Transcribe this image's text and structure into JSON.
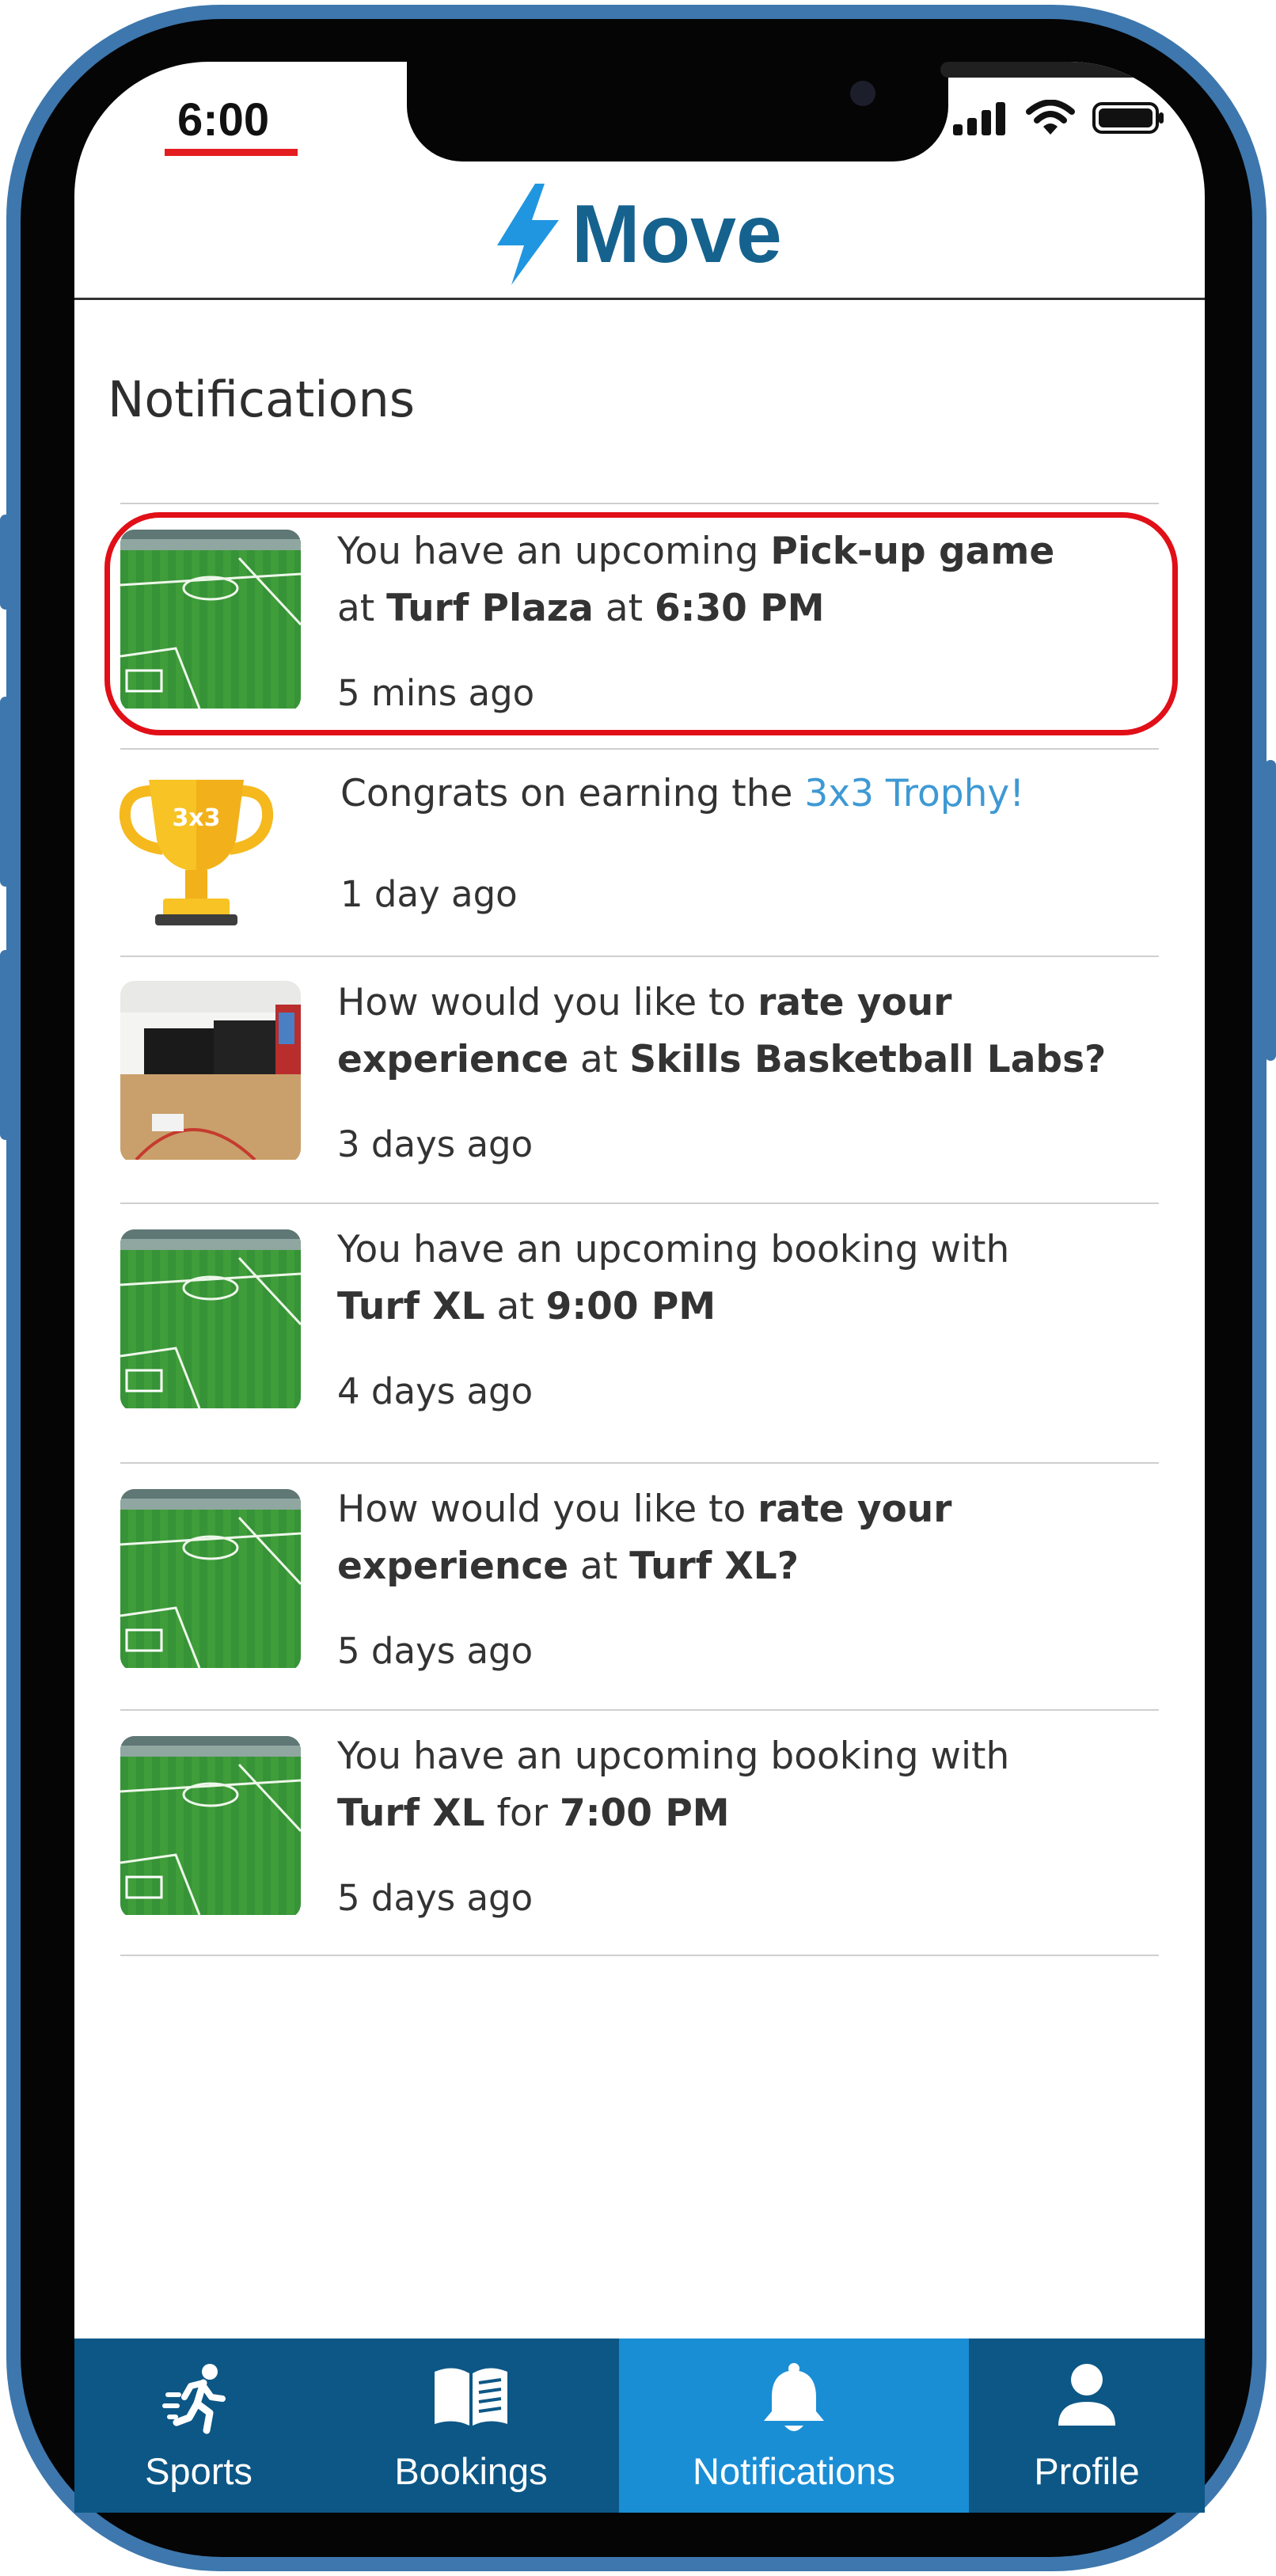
{
  "status_bar": {
    "time": "6:00"
  },
  "app": {
    "name": "Move"
  },
  "page": {
    "title": "Notifications"
  },
  "notifications": [
    {
      "thumb": "turf-field-photo",
      "line1": [
        {
          "text": "You have an upcoming ",
          "bold": false
        },
        {
          "text": "Pick-up game",
          "bold": true
        }
      ],
      "line2": [
        {
          "text": "at ",
          "bold": false
        },
        {
          "text": "Turf Plaza",
          "bold": true
        },
        {
          "text": " at ",
          "bold": false
        },
        {
          "text": "6:30 PM",
          "bold": true
        }
      ],
      "time": "5 mins ago",
      "highlighted": true
    },
    {
      "thumb": "trophy-icon",
      "trophy_label": "3x3",
      "line1": [
        {
          "text": "Congrats on earning the ",
          "bold": false
        },
        {
          "text": "3x3 Trophy!",
          "bold": false,
          "link": true
        }
      ],
      "line2": [],
      "time": "1 day ago"
    },
    {
      "thumb": "basketball-court-photo",
      "line1": [
        {
          "text": "How would you like to ",
          "bold": false
        },
        {
          "text": "rate your",
          "bold": true
        }
      ],
      "line2": [
        {
          "text": "experience",
          "bold": true
        },
        {
          "text": " at ",
          "bold": false
        },
        {
          "text": "Skills Basketball Labs?",
          "bold": true
        }
      ],
      "time": "3 days ago"
    },
    {
      "thumb": "turf-field-photo",
      "line1": [
        {
          "text": "You have an upcoming booking with",
          "bold": false
        }
      ],
      "line2": [
        {
          "text": "Turf XL",
          "bold": true
        },
        {
          "text": " at ",
          "bold": false
        },
        {
          "text": "9:00 PM",
          "bold": true
        }
      ],
      "time": "4 days ago"
    },
    {
      "thumb": "turf-field-photo",
      "line1": [
        {
          "text": "How would you like to ",
          "bold": false
        },
        {
          "text": "rate your",
          "bold": true
        }
      ],
      "line2": [
        {
          "text": "experience",
          "bold": true
        },
        {
          "text": " at ",
          "bold": false
        },
        {
          "text": "Turf XL?",
          "bold": true
        }
      ],
      "time": "5 days ago"
    },
    {
      "thumb": "turf-field-photo",
      "line1": [
        {
          "text": "You have an upcoming booking with",
          "bold": false
        }
      ],
      "line2": [
        {
          "text": "Turf XL",
          "bold": true
        },
        {
          "text": " for ",
          "bold": false
        },
        {
          "text": "7:00 PM",
          "bold": true
        }
      ],
      "time": "5 days ago"
    }
  ],
  "nav": {
    "items": [
      {
        "label": "Sports",
        "icon": "running-person-icon",
        "active": false
      },
      {
        "label": "Bookings",
        "icon": "open-book-icon",
        "active": false
      },
      {
        "label": "Notifications",
        "icon": "bell-icon",
        "active": true
      },
      {
        "label": "Profile",
        "icon": "person-icon",
        "active": false
      }
    ]
  },
  "colors": {
    "brand": "#16628e",
    "logo_bolt": "#2196e0",
    "nav_bg": "#0c5786",
    "nav_active": "#1a8ed5",
    "highlight": "#e10f17",
    "link": "#3e99d4"
  }
}
